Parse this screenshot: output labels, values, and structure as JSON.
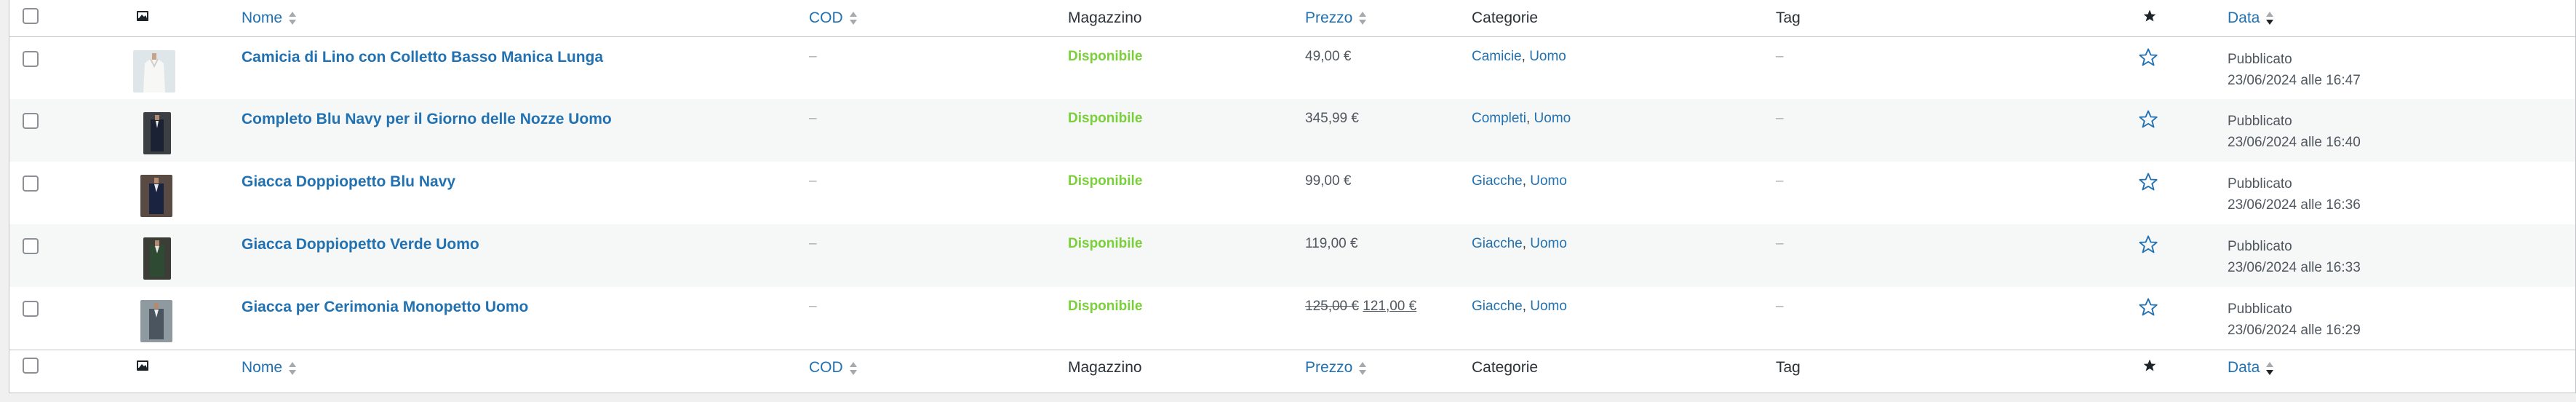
{
  "columns": {
    "name": "Nome",
    "cod": "COD",
    "stock": "Magazzino",
    "price": "Prezzo",
    "categories": "Categorie",
    "tag": "Tag",
    "date": "Data"
  },
  "icons": {
    "image_column": "image-icon",
    "featured_header": "star-filled-icon",
    "featured_row": "star-outline-icon",
    "sort": "sort-arrows-icon"
  },
  "colors": {
    "link": "#2271b1",
    "in_stock": "#7ad03a",
    "muted": "#a7aaad"
  },
  "products": [
    {
      "name": "Camicia di Lino con Colletto Basso Manica Lunga",
      "cod": "–",
      "stock": "Disponibile",
      "price": "49,00 €",
      "categories": [
        {
          "label": "Camicie"
        },
        {
          "label": "Uomo"
        }
      ],
      "tag": "–",
      "status": "Pubblicato",
      "date": "23/06/2024 alle 16:47"
    },
    {
      "name": "Completo Blu Navy per il Giorno delle Nozze Uomo",
      "cod": "–",
      "stock": "Disponibile",
      "price": "345,99 €",
      "categories": [
        {
          "label": "Completi"
        },
        {
          "label": "Uomo"
        }
      ],
      "tag": "–",
      "status": "Pubblicato",
      "date": "23/06/2024 alle 16:40"
    },
    {
      "name": "Giacca Doppiopetto Blu Navy",
      "cod": "–",
      "stock": "Disponibile",
      "price": "99,00 €",
      "categories": [
        {
          "label": "Giacche"
        },
        {
          "label": "Uomo"
        }
      ],
      "tag": "–",
      "status": "Pubblicato",
      "date": "23/06/2024 alle 16:36"
    },
    {
      "name": "Giacca Doppiopetto Verde Uomo",
      "cod": "–",
      "stock": "Disponibile",
      "price": "119,00 €",
      "categories": [
        {
          "label": "Giacche"
        },
        {
          "label": "Uomo"
        }
      ],
      "tag": "–",
      "status": "Pubblicato",
      "date": "23/06/2024 alle 16:33"
    },
    {
      "name": "Giacca per Cerimonia Monopetto Uomo",
      "cod": "–",
      "stock": "Disponibile",
      "price_old": "125,00 €",
      "price_new": "121,00 €",
      "categories": [
        {
          "label": "Giacche"
        },
        {
          "label": "Uomo"
        }
      ],
      "tag": "–",
      "status": "Pubblicato",
      "date": "23/06/2024 alle 16:29"
    }
  ]
}
